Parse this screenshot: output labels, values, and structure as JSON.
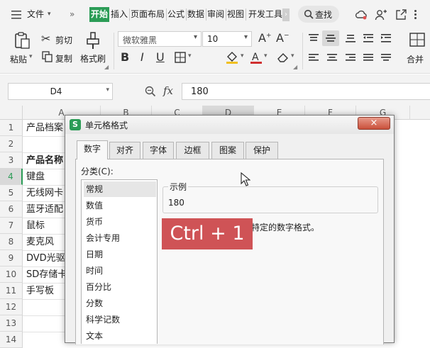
{
  "menubar": {
    "file_label": "文件",
    "tabs": [
      "开始",
      "插入",
      "页面布局",
      "公式",
      "数据",
      "审阅",
      "视图",
      "开发工具"
    ],
    "search_label": "查找"
  },
  "ribbon": {
    "paste_label": "粘贴",
    "cut_label": "剪切",
    "copy_label": "复制",
    "format_painter_label": "格式刷",
    "font_name": "微软雅黑",
    "font_size": "10",
    "merge_label": "合并"
  },
  "formula_bar": {
    "name_box": "D4",
    "fx_label": "fx",
    "formula": "180"
  },
  "grid": {
    "columns": [
      "A",
      "B",
      "C",
      "D",
      "E",
      "F",
      "G"
    ],
    "rows": [
      "1",
      "2",
      "3",
      "4",
      "5",
      "6",
      "7",
      "8",
      "9",
      "10",
      "11",
      "12",
      "13",
      "14"
    ],
    "cells": [
      "产品档案",
      "",
      "产品名称",
      "键盘",
      "无线网卡",
      "蓝牙适配",
      "鼠标",
      "麦克风",
      "DVD光驱",
      "SD存储卡",
      "手写板"
    ]
  },
  "dialog": {
    "title": "单元格格式",
    "close_label": "×",
    "tabs": [
      "数字",
      "对齐",
      "字体",
      "边框",
      "图案",
      "保护"
    ],
    "category_label": "分类(C):",
    "categories": [
      "常规",
      "数值",
      "货币",
      "会计专用",
      "日期",
      "时间",
      "百分比",
      "分数",
      "科学记数",
      "文本"
    ],
    "sample_title": "示例",
    "sample_value": "180",
    "description": "特定的数字格式。"
  },
  "overlay": {
    "shortcut": "Ctrl + 1"
  },
  "colors": {
    "accent": "#2b9c56",
    "overlay": "#cf5356",
    "close": "#c9503b"
  }
}
